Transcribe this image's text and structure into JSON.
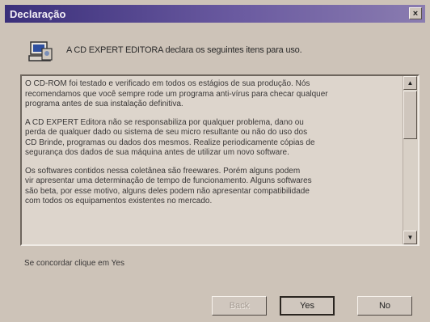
{
  "window": {
    "title": "Declaração",
    "close_label": "×"
  },
  "header": {
    "text": "A CD EXPERT EDITORA declara os seguintes itens para uso."
  },
  "paragraphs": [
    [
      "O CD-ROM foi testado e verificado em todos os estágios de sua produção. Nós",
      "recomendamos que você sempre rode um programa anti-vírus para checar qualquer",
      "programa antes de sua instalação definitiva."
    ],
    [
      "A CD EXPERT Editora não se responsabiliza por qualquer problema, dano ou",
      "perda de qualquer dado ou sistema de seu micro resultante ou não do uso dos",
      "CD Brinde, programas ou dados dos mesmos. Realize periodicamente cópias de",
      "segurança dos dados de sua máquina antes de utilizar um novo software."
    ],
    [
      "Os softwares contidos nessa coletânea são freewares. Porém alguns podem",
      "vir apresentar uma determinação de tempo de funcionamento. Alguns softwares",
      "são beta, por esse motivo, alguns deles podem não apresentar compatibilidade",
      "com todos os equipamentos existentes no mercado."
    ]
  ],
  "scroll": {
    "up": "▲",
    "down": "▼"
  },
  "prompt": "Se concordar clique em Yes",
  "buttons": {
    "back": "Back",
    "yes": "Yes",
    "no": "No"
  }
}
